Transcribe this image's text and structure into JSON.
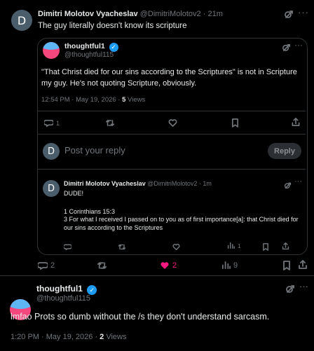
{
  "post1": {
    "avatar_letter": "D",
    "author": "Dimitri Molotov Vyacheslav",
    "handle": "@DimitriMolotov2",
    "time": "· 21m",
    "text": "The guy literally doesn't know its scripture",
    "actions": {
      "replies": "2",
      "reposts": "",
      "likes": "2",
      "views": "9"
    }
  },
  "quoted": {
    "author": "thoughtful1",
    "handle": "@thoughtful115",
    "text": "\"That Christ died for our sins according to the Scriptures\" is not in Scripture my guy. He's not quoting Scripture, obviously.",
    "timestamp": "12:54 PM · May 19, 2026 · ",
    "views_count": "5",
    "views_label": " Views",
    "actions": {
      "replies": "1"
    },
    "compose": {
      "avatar_letter": "D",
      "placeholder": "Post your reply",
      "reply_label": "Reply"
    },
    "nested": {
      "avatar_letter": "D",
      "author": "Dimitri Molotov Vyacheslav",
      "handle": "@DimitriMolotov2 · 1m",
      "line1": "DUDE!",
      "line2": "1 Corinthians 15:3",
      "line3": "3 For what I received I passed on to you as of first importance[a]: that Christ died for our sins according to the Scriptures",
      "views": "1"
    }
  },
  "post2": {
    "author": "thoughtful1",
    "handle": "@thoughtful115",
    "text": "lmfao Prots so dumb without the /s they don't understand sarcasm.",
    "timestamp": "1:20 PM · May 19, 2026 · ",
    "views_count": "2",
    "views_label": " Views"
  },
  "colors": {
    "accent": "#1d9bf0",
    "like": "#f91880",
    "muted": "#71767b",
    "border": "#2f3336"
  }
}
